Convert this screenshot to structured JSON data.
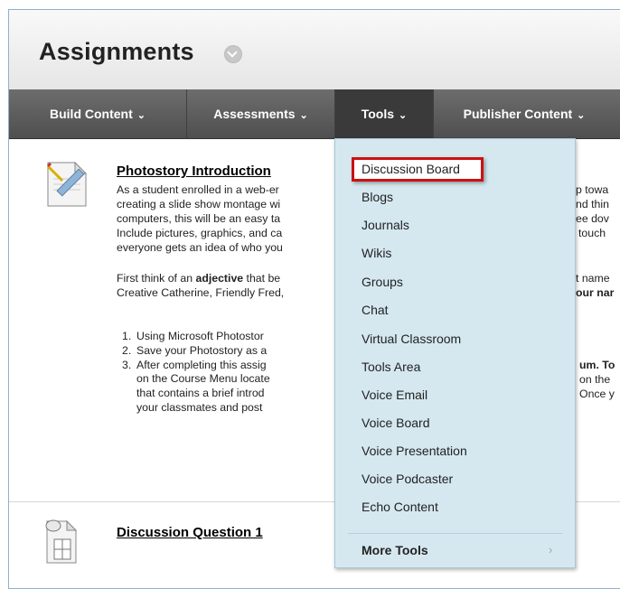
{
  "page": {
    "title": "Assignments"
  },
  "action_bar": {
    "items": [
      {
        "label": "Build Content"
      },
      {
        "label": "Assessments"
      },
      {
        "label": "Tools"
      },
      {
        "label": "Publisher Content"
      }
    ],
    "chevron": "⌄"
  },
  "items": [
    {
      "title": "Photostory Introduction",
      "icon": "assignment-document-icon",
      "lines": [
        "As a student enrolled in a web-er",
        "creating a slide show montage wi",
        "computers, this will be an easy ta",
        "Include pictures, graphics, and ca",
        "everyone gets an idea of who you"
      ],
      "right_fragments": [
        "p towa",
        "nd thin",
        "ee dov",
        "touch",
        ""
      ],
      "para2_line1_pre": "First think of an ",
      "para2_line1_bold": "adjective",
      "para2_line1_post": " that be",
      "para2_line1_right": "t name",
      "para2_line2": "Creative Catherine, Friendly Fred,",
      "para2_line2_right": "our nar",
      "list": [
        {
          "num": "1.",
          "text": "Using Microsoft Photostor",
          "right": ""
        },
        {
          "num": "2.",
          "text": "Save your Photostory as a",
          "right": ""
        },
        {
          "num": "3.",
          "text": "After completing this assig",
          "right": "um. To"
        },
        {
          "num": "",
          "text": "on the Course Menu locate",
          "right": "on the"
        },
        {
          "num": "",
          "text": "that contains a brief introd",
          "right": "Once y"
        },
        {
          "num": "",
          "text": "your classmates and post",
          "right": ""
        }
      ]
    },
    {
      "title": "Discussion Question 1",
      "icon": "discussion-document-icon"
    }
  ],
  "tools_menu": {
    "items": [
      "Discussion Board",
      "Blogs",
      "Journals",
      "Wikis",
      "Groups",
      "Chat",
      "Virtual Classroom",
      "Tools Area",
      "Voice Email",
      "Voice Board",
      "Voice Presentation",
      "Voice Podcaster",
      "Echo Content"
    ],
    "more": "More Tools",
    "more_arrow": "›",
    "highlight_color": "#cc1010"
  }
}
